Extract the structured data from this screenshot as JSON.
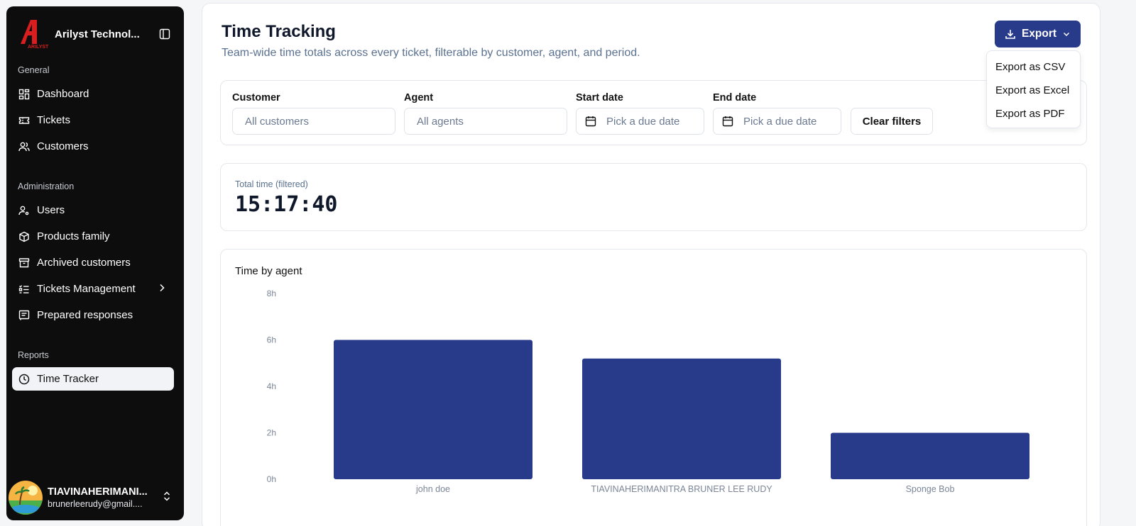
{
  "brand": {
    "name": "Arilyst Technol...",
    "logo_text": "ARILYST"
  },
  "sidebar": {
    "sections": [
      {
        "label": "General"
      },
      {
        "label": "Administration"
      },
      {
        "label": "Reports"
      }
    ],
    "items": [
      {
        "label": "Dashboard",
        "icon": "dashboard-icon"
      },
      {
        "label": "Tickets",
        "icon": "ticket-icon"
      },
      {
        "label": "Customers",
        "icon": "customers-icon"
      },
      {
        "label": "Users",
        "icon": "user-gear-icon"
      },
      {
        "label": "Products family",
        "icon": "package-icon"
      },
      {
        "label": "Archived customers",
        "icon": "archive-icon"
      },
      {
        "label": "Tickets Management",
        "icon": "list-check-icon"
      },
      {
        "label": "Prepared responses",
        "icon": "message-square-icon"
      },
      {
        "label": "Time Tracker",
        "icon": "clock-icon",
        "active": true
      }
    ]
  },
  "user": {
    "name": "TIAVINAHERIMANI...",
    "email": "brunerleerudy@gmail...."
  },
  "page": {
    "title": "Time Tracking",
    "subtitle": "Team-wide time totals across every ticket, filterable by customer, agent, and period."
  },
  "export": {
    "label": "Export",
    "menu": [
      "Export as CSV",
      "Export as Excel",
      "Export as PDF"
    ]
  },
  "filters": {
    "customer": {
      "label": "Customer",
      "placeholder": "All customers"
    },
    "agent": {
      "label": "Agent",
      "placeholder": "All agents"
    },
    "start_date": {
      "label": "Start date",
      "placeholder": "Pick a due date"
    },
    "end_date": {
      "label": "End date",
      "placeholder": "Pick a due date"
    },
    "clear_label": "Clear filters"
  },
  "total": {
    "label": "Total time (filtered)",
    "value": "15:17:40"
  },
  "colors": {
    "accent": "#283a8a",
    "bar": "#283a8a"
  },
  "chart_data": {
    "type": "bar",
    "title": "Time by agent",
    "categories": [
      "john doe",
      "TIAVINAHERIMANITRA BRUNER LEE RUDY",
      "Sponge Bob"
    ],
    "values": [
      6.0,
      5.2,
      2.0
    ],
    "unit": "h",
    "ylim": [
      0,
      8
    ],
    "yticks": [
      "0h",
      "2h",
      "4h",
      "6h",
      "8h"
    ],
    "xlabel": "",
    "ylabel": "",
    "grid": false
  }
}
